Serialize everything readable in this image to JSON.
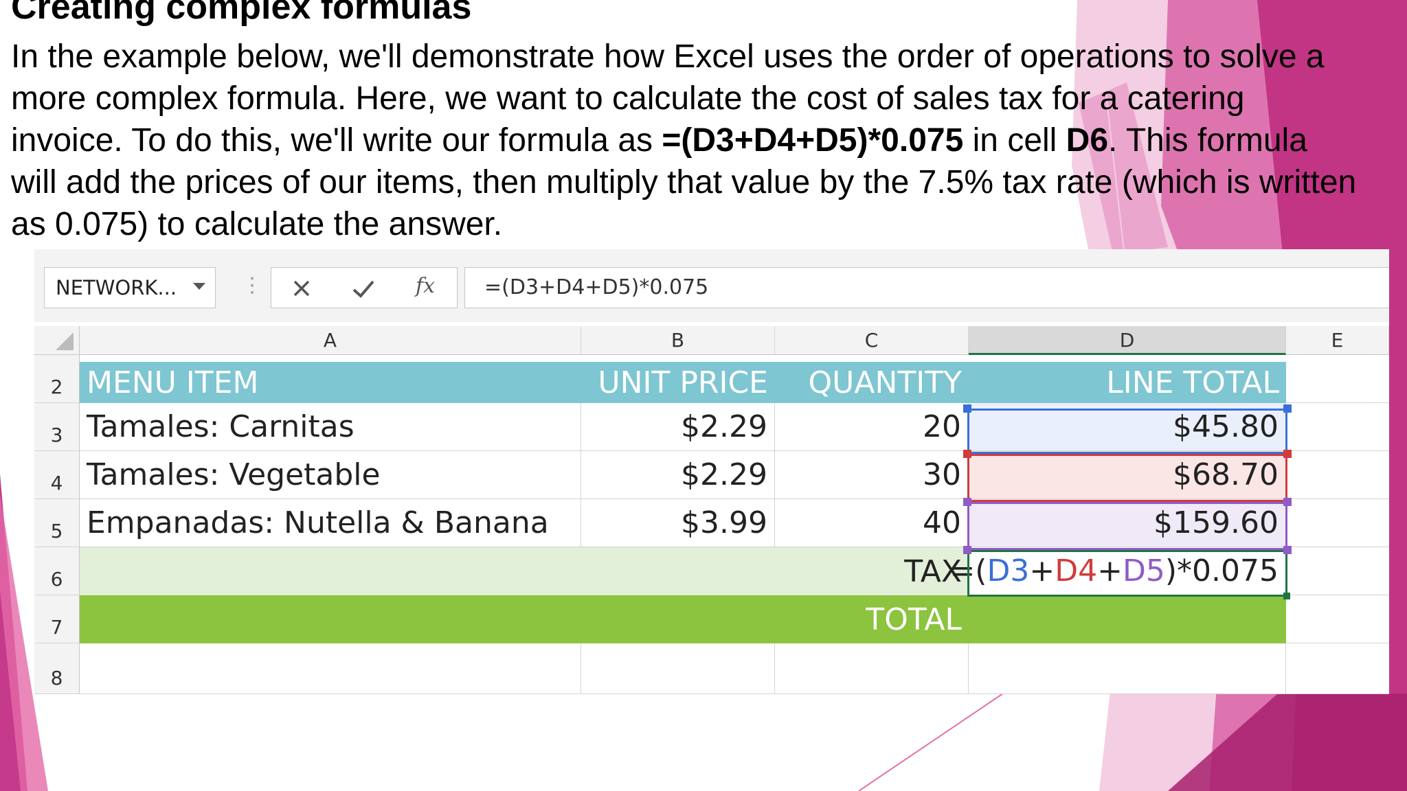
{
  "slide": {
    "title": "Creating complex formulas",
    "body": {
      "p1": "In the example below, we'll demonstrate how Excel uses the order of operations to solve a more complex formula. Here, we want to calculate the cost of sales tax for a catering invoice. To do this, we'll write our formula as ",
      "formula_bold": "=(D3+D4+D5)*0.075",
      "p2": " in cell ",
      "cell_bold": "D6",
      "p3": ". This formula will add the prices of our items, then multiply that value by the 7.5% tax rate (which is written as 0.075) to calculate the answer."
    }
  },
  "formula_bar": {
    "name_box": "NETWORK...",
    "cancel_icon": "x-icon",
    "enter_icon": "check-icon",
    "function_icon": "fx-icon",
    "formula": "=(D3+D4+D5)*0.075"
  },
  "columns": [
    "A",
    "B",
    "C",
    "D",
    "E"
  ],
  "rows": [
    "2",
    "3",
    "4",
    "5",
    "6",
    "7",
    "8"
  ],
  "table": {
    "headers": [
      "MENU ITEM",
      "UNIT PRICE",
      "QUANTITY",
      "LINE TOTAL"
    ],
    "items": [
      {
        "menu_item": "Tamales: Carnitas",
        "unit_price": "$2.29",
        "quantity": "20",
        "line_total": "$45.80"
      },
      {
        "menu_item": "Tamales: Vegetable",
        "unit_price": "$2.29",
        "quantity": "30",
        "line_total": "$68.70"
      },
      {
        "menu_item": "Empanadas: Nutella & Banana",
        "unit_price": "$3.99",
        "quantity": "40",
        "line_total": "$159.60"
      }
    ],
    "tax_label": "TAX",
    "tax_formula": {
      "p1": "=(",
      "r1": "D3",
      "plus1": "+",
      "r2": "D4",
      "plus2": "+",
      "r3": "D5",
      "p2": ")*0.075"
    },
    "total_label": "TOTAL"
  },
  "colors": {
    "header_band": "#7ec6d1",
    "tax_band": "#e2efd9",
    "total_band": "#8cc33f",
    "ref_d3": "#3a6fd8",
    "ref_d4": "#d13b3b",
    "ref_d5": "#8f5cc7",
    "active_cell": "#217346",
    "accent_pink": "#c8348f"
  }
}
